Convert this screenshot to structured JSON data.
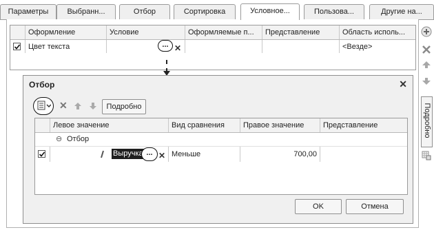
{
  "tabs": [
    "Параметры",
    "Выбранн...",
    "Отбор",
    "Сортировка",
    "Условное...",
    "Пользова...",
    "Другие на..."
  ],
  "main_grid": {
    "columns": [
      "Оформление",
      "Условие",
      "Оформляемые п...",
      "Представление",
      "Область исполь..."
    ],
    "row": {
      "appearance": "Цвет текста",
      "condition": "",
      "fields": "",
      "presentation": "",
      "area": "<Везде>"
    },
    "dots": "..."
  },
  "side": {
    "vertical_tab": "Подробно"
  },
  "dialog": {
    "title": "Отбор",
    "details_button": "Подробно",
    "columns": [
      "Левое значение",
      "Вид сравнения",
      "Правое значение",
      "Представление"
    ],
    "group_label": "Отбор",
    "row": {
      "left": "Выручка",
      "comparison": "Меньше",
      "right": "700,00",
      "presentation": ""
    },
    "dots": "...",
    "ok_button": "OK",
    "cancel_button": "Отмена"
  },
  "colors": {
    "selection": "#1f1f1f",
    "highlight_text": "#ffffff"
  }
}
